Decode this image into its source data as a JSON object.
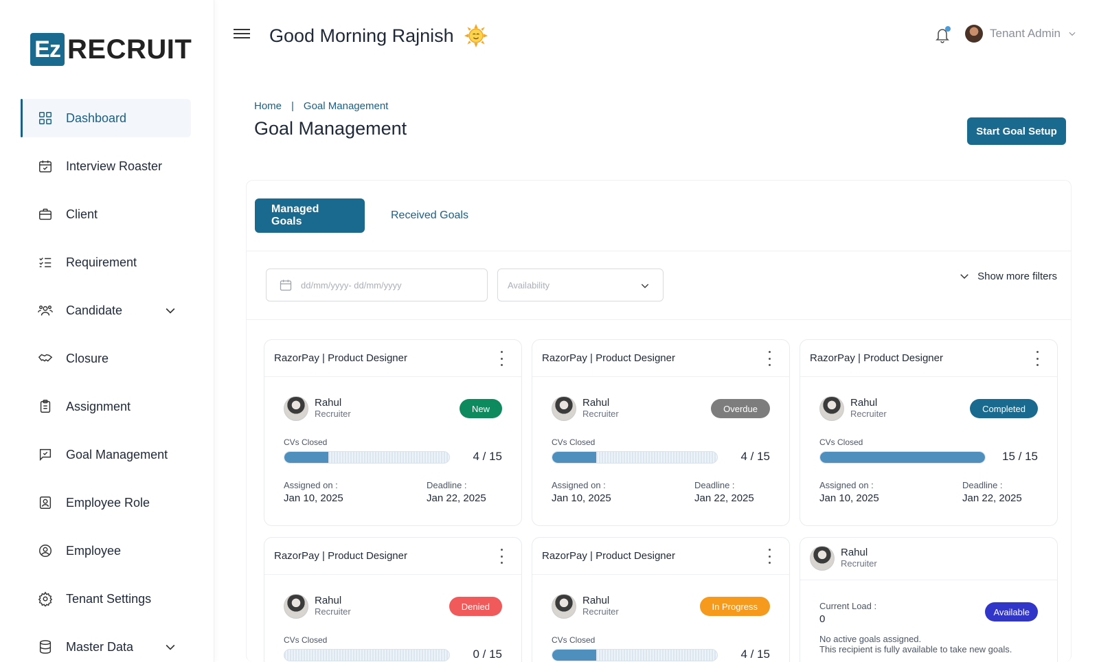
{
  "brand": {
    "logo_mark": "Ez",
    "logo_text": "RECRUIT"
  },
  "sidebar": {
    "items": [
      {
        "label": "Dashboard",
        "icon": "grid-icon",
        "active": true
      },
      {
        "label": "Interview Roaster",
        "icon": "calendar-check-icon"
      },
      {
        "label": "Client",
        "icon": "briefcase-icon"
      },
      {
        "label": "Requirement",
        "icon": "checklist-icon"
      },
      {
        "label": "Candidate",
        "icon": "users-icon",
        "expandable": true
      },
      {
        "label": "Closure",
        "icon": "handshake-icon"
      },
      {
        "label": "Assignment",
        "icon": "clipboard-icon"
      },
      {
        "label": "Goal Management",
        "icon": "goal-icon"
      },
      {
        "label": "Employee Role",
        "icon": "id-badge-icon"
      },
      {
        "label": "Employee",
        "icon": "user-circle-icon"
      },
      {
        "label": "Tenant Settings",
        "icon": "gear-icon"
      },
      {
        "label": "Master Data",
        "icon": "database-icon",
        "expandable": true
      }
    ]
  },
  "header": {
    "greeting": "Good Morning Rajnish",
    "user_name": "Tenant Admin"
  },
  "breadcrumb": {
    "home": "Home",
    "current": "Goal Management"
  },
  "page": {
    "title": "Goal Management",
    "start_button": "Start Goal Setup"
  },
  "tabs": {
    "managed": "Managed Goals",
    "received": "Received Goals"
  },
  "filters": {
    "date_placeholder": "dd/mm/yyyy- dd/mm/yyyy",
    "availability_placeholder": "Availability",
    "more_filters": "Show more filters"
  },
  "colors": {
    "primary": "#1a6a8f",
    "new": "#0e8a5f",
    "overdue": "#7d7d7d",
    "completed": "#1a6a8f",
    "denied": "#f05a5a",
    "in_progress": "#f59a1c",
    "available": "#3136c9"
  },
  "goal_cards": [
    {
      "title": "RazorPay | Product Designer",
      "name": "Rahul",
      "role": "Recruiter",
      "status": "New",
      "status_color": "#0e8a5f",
      "cv_label": "CVs Closed",
      "closed": 4,
      "total": 15,
      "score": "4 / 15",
      "assigned_label": "Assigned on :",
      "assigned": "Jan 10, 2025",
      "deadline_label": "Deadline :",
      "deadline": "Jan 22, 2025"
    },
    {
      "title": "RazorPay | Product Designer",
      "name": "Rahul",
      "role": "Recruiter",
      "status": "Overdue",
      "status_color": "#7d7d7d",
      "cv_label": "CVs Closed",
      "closed": 4,
      "total": 15,
      "score": "4 / 15",
      "assigned_label": "Assigned on :",
      "assigned": "Jan 10, 2025",
      "deadline_label": "Deadline :",
      "deadline": "Jan 22, 2025"
    },
    {
      "title": "RazorPay | Product Designer",
      "name": "Rahul",
      "role": "Recruiter",
      "status": "Completed",
      "status_color": "#1a6a8f",
      "cv_label": "CVs Closed",
      "closed": 15,
      "total": 15,
      "score": "15 / 15",
      "assigned_label": "Assigned on :",
      "assigned": "Jan 10, 2025",
      "deadline_label": "Deadline :",
      "deadline": "Jan 22, 2025"
    },
    {
      "title": "RazorPay | Product Designer",
      "name": "Rahul",
      "role": "Recruiter",
      "status": "Denied",
      "status_color": "#f05a5a",
      "cv_label": "CVs Closed",
      "closed": 0,
      "total": 15,
      "score": "0 / 15"
    },
    {
      "title": "RazorPay | Product Designer",
      "name": "Rahul",
      "role": "Recruiter",
      "status": "In Progress",
      "status_color": "#f59a1c",
      "cv_label": "CVs Closed",
      "closed": 4,
      "total": 15,
      "score": "4 / 15"
    }
  ],
  "availability_card": {
    "name": "Rahul",
    "role": "Recruiter",
    "load_label": "Current Load :",
    "load_value": "0",
    "status": "Available",
    "note_line1": "No active goals assigned.",
    "note_line2": "This recipient is fully available to take new goals."
  }
}
